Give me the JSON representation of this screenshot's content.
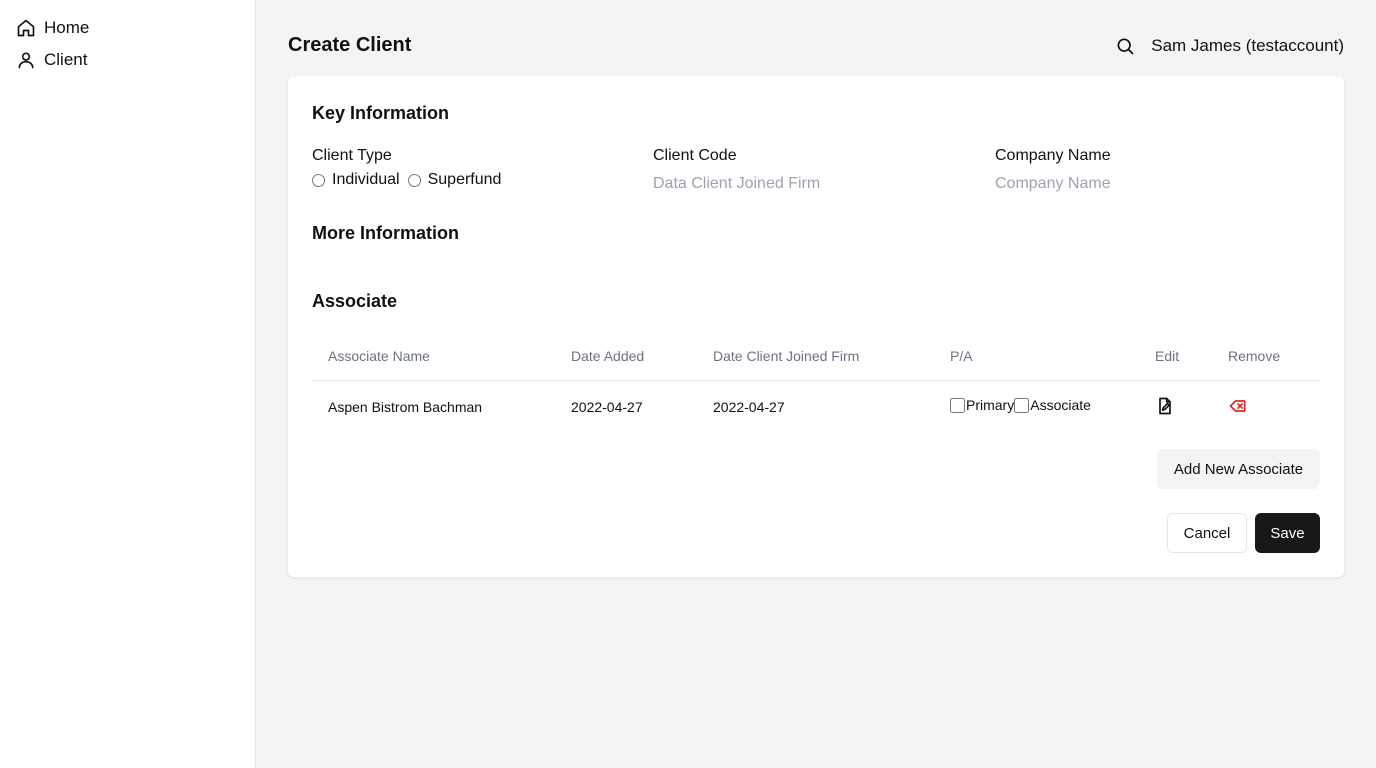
{
  "sidebar": {
    "items": [
      {
        "label": "Home",
        "icon": "home-icon"
      },
      {
        "label": "Client",
        "icon": "user-icon"
      }
    ]
  },
  "header": {
    "title": "Create Client",
    "user": "Sam James (testaccount)"
  },
  "key_information": {
    "title": "Key Information",
    "client_type": {
      "label": "Client Type",
      "options": [
        "Individual",
        "Superfund"
      ]
    },
    "client_code": {
      "label": "Client Code",
      "placeholder": "Data Client Joined Firm",
      "value": ""
    },
    "company_name": {
      "label": "Company Name",
      "placeholder": "Company Name",
      "value": ""
    }
  },
  "more_information": {
    "title": "More Information"
  },
  "associate": {
    "title": "Associate",
    "columns": [
      "Associate Name",
      "Date Added",
      "Date Client Joined Firm",
      "P/A",
      "Edit",
      "Remove"
    ],
    "rows": [
      {
        "name": "Aspen Bistrom Bachman",
        "date_added": "2022-04-27",
        "date_joined": "2022-04-27",
        "primary_label": "Primary",
        "associate_label": "Associate"
      }
    ],
    "add_button": "Add New Associate"
  },
  "actions": {
    "cancel": "Cancel",
    "save": "Save"
  },
  "colors": {
    "remove_icon": "#dc2626",
    "save_button": "#18181b",
    "background": "#f3f4f6"
  }
}
